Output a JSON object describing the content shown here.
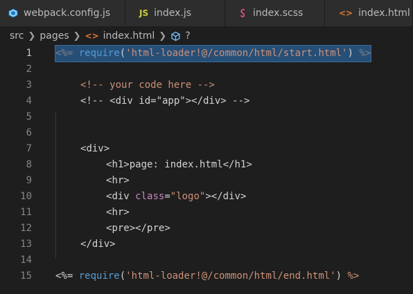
{
  "tabs": [
    {
      "icon": "webpack-icon",
      "label": "webpack.config.js"
    },
    {
      "icon": "js-icon",
      "icon_text": "JS",
      "label": "index.js"
    },
    {
      "icon": "scss-icon",
      "label": "index.scss"
    },
    {
      "icon": "html-icon",
      "icon_text": "<>",
      "label": "index.html"
    }
  ],
  "breadcrumb": {
    "items": [
      "src",
      "pages",
      "index.html",
      "?"
    ],
    "html_icon_text": "<>"
  },
  "editor": {
    "line_numbers": [
      "1",
      "2",
      "3",
      "4",
      "5",
      "6",
      "7",
      "8",
      "9",
      "10",
      "11",
      "12",
      "13",
      "14",
      "15"
    ],
    "lines": {
      "l1": {
        "open": "<%=",
        "require": "require",
        "paren_open": "(",
        "str": "'html-loader!@/common/html/start.html'",
        "paren_close": ")",
        "close": "%>"
      },
      "l3": "<!-- your code here -->",
      "l4": "<!-- <div id=\"app\"></div> -->",
      "l7": {
        "lt": "<",
        "name": "div",
        "gt": ">"
      },
      "l8": {
        "lt": "<",
        "name": "h1",
        "gt": ">",
        "text": "page: index.html",
        "lt2": "</",
        "name2": "h1",
        "gt2": ">"
      },
      "l9": {
        "lt": "<",
        "name": "hr",
        "gt": ">"
      },
      "l10": {
        "lt": "<",
        "name": "div",
        "attr": "class",
        "eq": "=",
        "val": "\"logo\"",
        "gt": ">",
        "lt2": "</",
        "name2": "div",
        "gt2": ">"
      },
      "l11": {
        "lt": "<",
        "name": "hr",
        "gt": ">"
      },
      "l12": {
        "lt": "<",
        "name": "pre",
        "gt": ">",
        "lt2": "</",
        "name2": "pre",
        "gt2": ">"
      },
      "l13": {
        "lt": "</",
        "name": "div",
        "gt": ">"
      },
      "l15": {
        "open": "<%=",
        "require": "require",
        "paren_open": "(",
        "str": "'html-loader!@/common/html/end.html'",
        "paren_close": ")",
        "close": "%>"
      }
    }
  },
  "colors": {
    "background": "#1e1e1e",
    "selection": "#264f78",
    "tag": "#569cd6",
    "string": "#ce9178",
    "attribute": "#9cdcfe"
  }
}
